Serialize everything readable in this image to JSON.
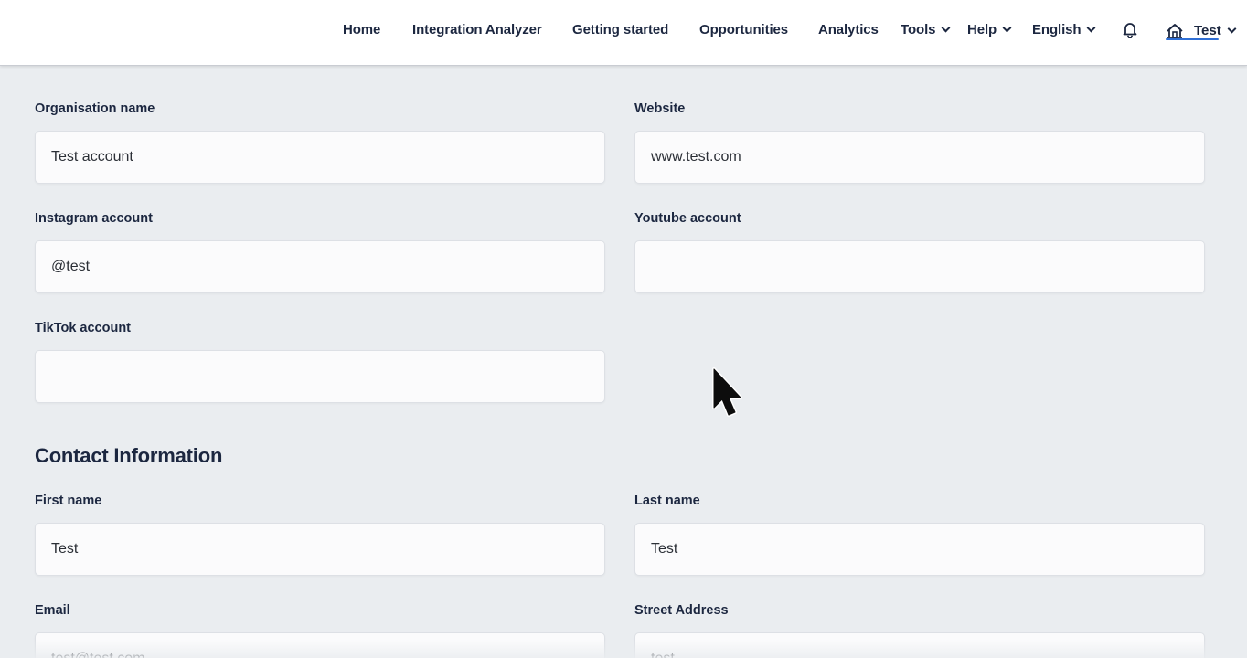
{
  "nav": {
    "items": [
      {
        "label": "Home"
      },
      {
        "label": "Integration Analyzer"
      },
      {
        "label": "Getting started"
      },
      {
        "label": "Opportunities"
      },
      {
        "label": "Analytics"
      }
    ],
    "dropdowns": [
      {
        "label": "Tools"
      },
      {
        "label": "Help"
      },
      {
        "label": "English"
      }
    ],
    "notifications_icon": "bell-icon",
    "account": {
      "label": "Test",
      "icon": "organisation-icon"
    },
    "accent_color": "#2f6fd6"
  },
  "form": {
    "organisation_name": {
      "label": "Organisation name",
      "value": "Test account"
    },
    "website": {
      "label": "Website",
      "value": "www.test.com"
    },
    "instagram": {
      "label": "Instagram account",
      "value": "@test"
    },
    "youtube": {
      "label": "Youtube account",
      "value": ""
    },
    "tiktok": {
      "label": "TikTok account",
      "value": ""
    }
  },
  "contact": {
    "title": "Contact Information",
    "first_name": {
      "label": "First name",
      "value": "Test"
    },
    "last_name": {
      "label": "Last name",
      "value": "Test"
    },
    "email": {
      "label": "Email",
      "value": "test@test.com"
    },
    "street_address": {
      "label": "Street Address",
      "value": "test"
    }
  },
  "cursor": {
    "icon": "mouse-pointer-icon"
  }
}
